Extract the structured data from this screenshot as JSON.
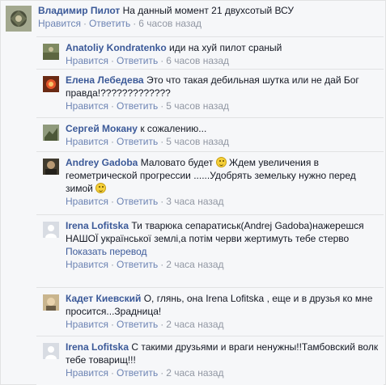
{
  "top": {
    "name": "Владимир Пилот",
    "text": "На данный момент 21 двухсотый ВСУ",
    "like": "Нравится",
    "reply": "Ответить",
    "time": "6 часов назад"
  },
  "replies": [
    {
      "name": "Anatoliy Kondratenko",
      "text": "иди на хуй пилот сраный",
      "like": "Нравится",
      "reply": "Ответить",
      "time": "6 часов назад"
    },
    {
      "name": "Елена Лебедева",
      "text": "Это что такая дебильная шутка или не дай Бог правда!?????????????",
      "like": "Нравится",
      "reply": "Ответить",
      "time": "5 часов назад"
    },
    {
      "name": "Сергей Мокану",
      "text": "к сожалению...",
      "like": "Нравится",
      "reply": "Ответить",
      "time": "5 часов назад"
    },
    {
      "name": "Andrey Gadoba",
      "text_a": "Маловато будет",
      "text_b": "Ждем увеличения в геометрической прогрессии ......Удобрять земельку нужно перед зимой",
      "like": "Нравится",
      "reply": "Ответить",
      "time": "3 часа назад"
    },
    {
      "name": "Irena Lofitska",
      "text": "Ти тварюка сепаратиськ(Andrej Gadoba)нажерешся НАШОЇ української землі,а потім черви жертимуть тебе стерво",
      "translate": "Показать перевод",
      "like": "Нравится",
      "reply": "Ответить",
      "time": "2 часа назад"
    },
    {
      "name": "Кадет Киевский",
      "text": "О, глянь, она Irena Lofitska , еще и в друзья ко мне просится...Зрадница!",
      "like": "Нравится",
      "reply": "Ответить",
      "time": "2 часа назад"
    },
    {
      "name": "Irena Lofitska",
      "text": "С такими друзьями и враги ненужны!!Тамбовский волк тебе товарищ!!!",
      "like": "Нравится",
      "reply": "Ответить",
      "time": "2 часа назад"
    }
  ]
}
